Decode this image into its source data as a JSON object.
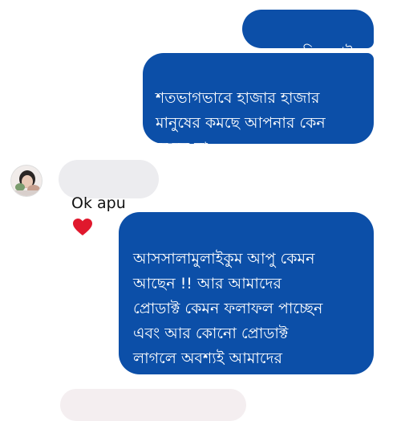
{
  "messages": [
    {
      "direction": "outgoing",
      "text": "ভয়ের কিছু নাই"
    },
    {
      "direction": "outgoing",
      "text": "শতভাগভাবে  হাজার হাজার\nমানুষের কমছে আপনার কেন\nকমবে না"
    },
    {
      "direction": "incoming",
      "text": "Ok apu",
      "icon": "red-heart-emoji"
    },
    {
      "direction": "outgoing",
      "text": "আসসালামুলাইকুম আপু কেমন\nআছেন !!     আর আমাদের\nপ্রোডাক্ট কেমন ফলাফল পাচ্ছেন\nএবং আর কোনো প্রোডাক্ট\nলাগলে অবশ্যই আমাদের\nজানাবেন ধন্যবাদ"
    }
  ],
  "colors": {
    "outgoing_bubble": "#0c4fa8",
    "incoming_bubble": "#ececef",
    "heart": "#e0182d"
  },
  "sender_avatar": "profile-photo"
}
